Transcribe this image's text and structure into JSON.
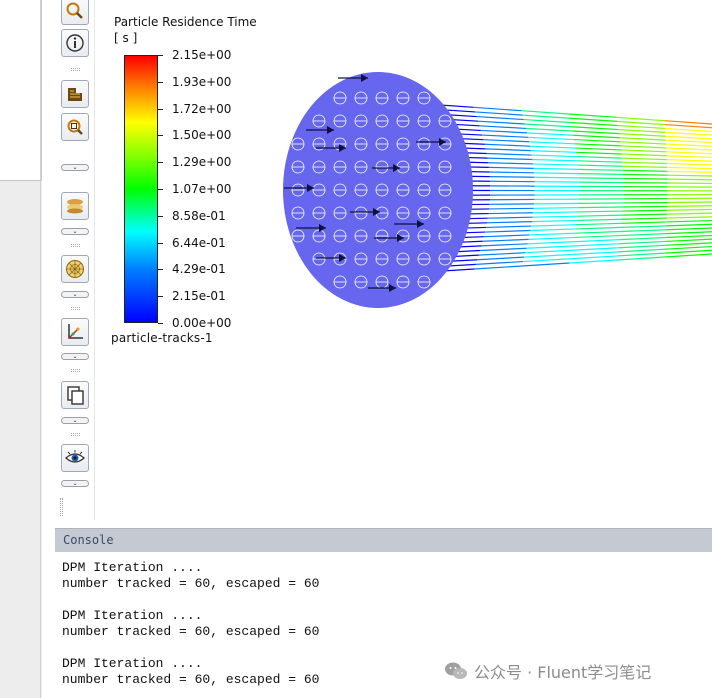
{
  "legend": {
    "title": "Particle Residence Time",
    "unit": "[ s ]",
    "labels": [
      "2.15e+00",
      "1.93e+00",
      "1.72e+00",
      "1.50e+00",
      "1.29e+00",
      "1.07e+00",
      "8.58e-01",
      "6.44e-01",
      "4.29e-01",
      "2.15e-01",
      "0.00e+00"
    ],
    "colormap": [
      "#ff0000",
      "#ff8000",
      "#ffff00",
      "#80ff00",
      "#00ff00",
      "#00ff80",
      "#00ffff",
      "#0080ff",
      "#0000ff"
    ]
  },
  "tracks_label": "particle-tracks-1",
  "toolbar": {
    "icons": [
      "zoom-icon",
      "info-icon",
      "mesh-display-icon",
      "zoom-to-fit-icon",
      "contours-icon",
      "sphere-mesh-icon",
      "axes-icon",
      "copy-window-icon",
      "view-eye-icon"
    ]
  },
  "console": {
    "title": "Console",
    "lines": [
      "DPM Iteration ....",
      "number tracked = 60, escaped = 60",
      "",
      "DPM Iteration ....",
      "number tracked = 60, escaped = 60",
      "",
      "DPM Iteration ....",
      "number tracked = 60, escaped = 60"
    ]
  },
  "watermark": {
    "text": "公众号 · Fluent学习笔记"
  },
  "colors": {
    "inlet_face": "#6666ee",
    "console_header": "#c5cad2"
  }
}
